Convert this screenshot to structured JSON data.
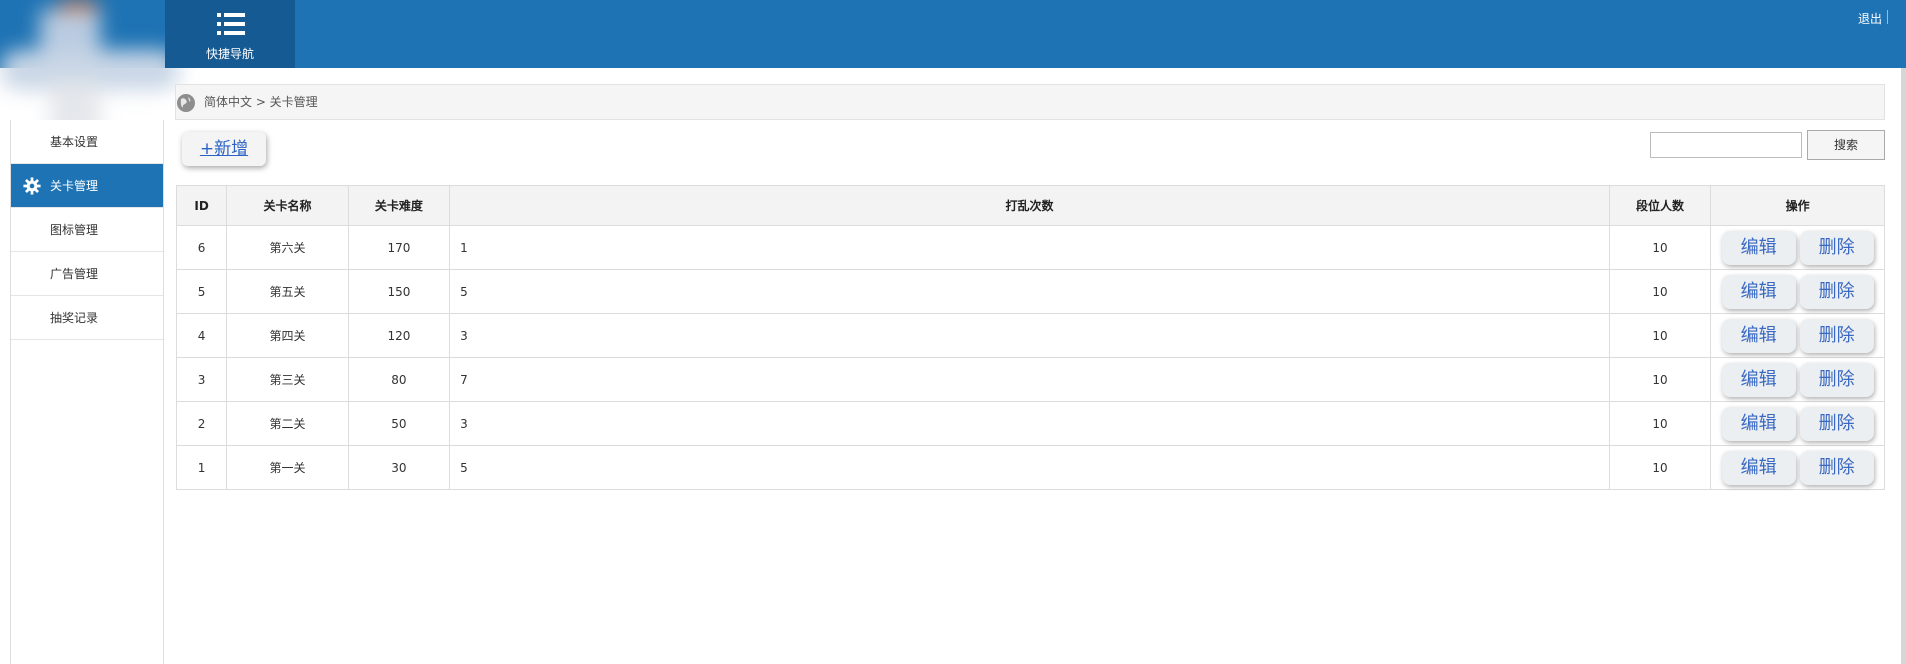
{
  "header": {
    "quick_nav_label": "快捷导航",
    "logout_label": "退出"
  },
  "sidebar": {
    "items": [
      {
        "label": "基本设置",
        "active": false
      },
      {
        "label": "关卡管理",
        "active": true
      },
      {
        "label": "图标管理",
        "active": false
      },
      {
        "label": "广告管理",
        "active": false
      },
      {
        "label": "抽奖记录",
        "active": false
      }
    ]
  },
  "breadcrumb": {
    "text": "简体中文 > 关卡管理"
  },
  "toolbar": {
    "add_label": "+新增",
    "search_value": "",
    "search_label": "搜索"
  },
  "table": {
    "columns": [
      "ID",
      "关卡名称",
      "关卡难度",
      "打乱次数",
      "段位人数",
      "操作"
    ],
    "edit_label": "编辑",
    "delete_label": "删除",
    "rows": [
      {
        "id": "6",
        "name": "第六关",
        "difficulty": "170",
        "shuffle": "1",
        "rank": "10"
      },
      {
        "id": "5",
        "name": "第五关",
        "difficulty": "150",
        "shuffle": "5",
        "rank": "10"
      },
      {
        "id": "4",
        "name": "第四关",
        "difficulty": "120",
        "shuffle": "3",
        "rank": "10"
      },
      {
        "id": "3",
        "name": "第三关",
        "difficulty": "80",
        "shuffle": "7",
        "rank": "10"
      },
      {
        "id": "2",
        "name": "第二关",
        "difficulty": "50",
        "shuffle": "3",
        "rank": "10"
      },
      {
        "id": "1",
        "name": "第一关",
        "difficulty": "30",
        "shuffle": "5",
        "rank": "10"
      }
    ]
  },
  "colors": {
    "primary": "#1e73b4",
    "nav_dark": "#155a93",
    "link": "#2a63c5"
  }
}
